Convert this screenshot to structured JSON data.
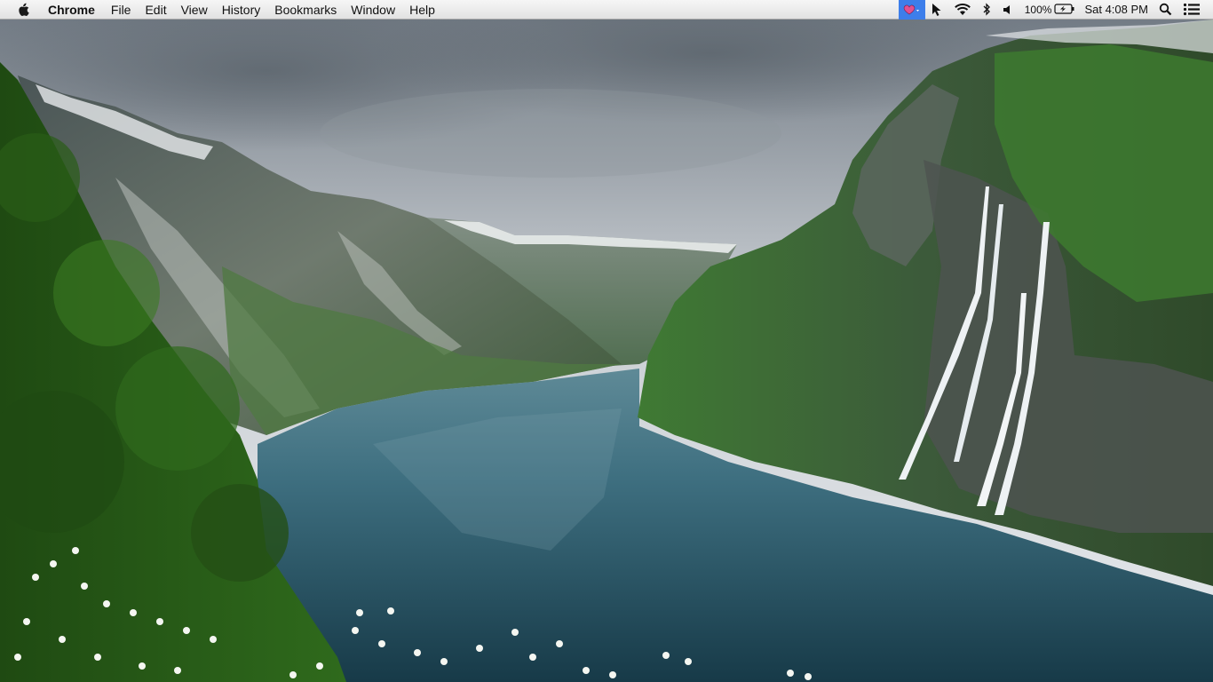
{
  "menubar": {
    "apple_icon": "apple-logo-icon",
    "app_name": "Chrome",
    "items": [
      "File",
      "Edit",
      "View",
      "History",
      "Bookmarks",
      "Window",
      "Help"
    ],
    "status": {
      "app_extra_icon": "pink-heart-app-icon",
      "cursor_icon": "cursor-arrow-icon",
      "wifi_icon": "wifi-icon",
      "bluetooth_icon": "bluetooth-icon",
      "volume_icon": "volume-icon",
      "battery_percent": "100%",
      "battery_icon": "battery-charging-icon",
      "clock": "Sat 4:08 PM",
      "spotlight_icon": "spotlight-search-icon",
      "notification_icon": "notification-center-icon"
    },
    "highlight_color": "#3d7eea"
  },
  "desktop": {
    "wallpaper": "fjord-with-waterfalls"
  }
}
